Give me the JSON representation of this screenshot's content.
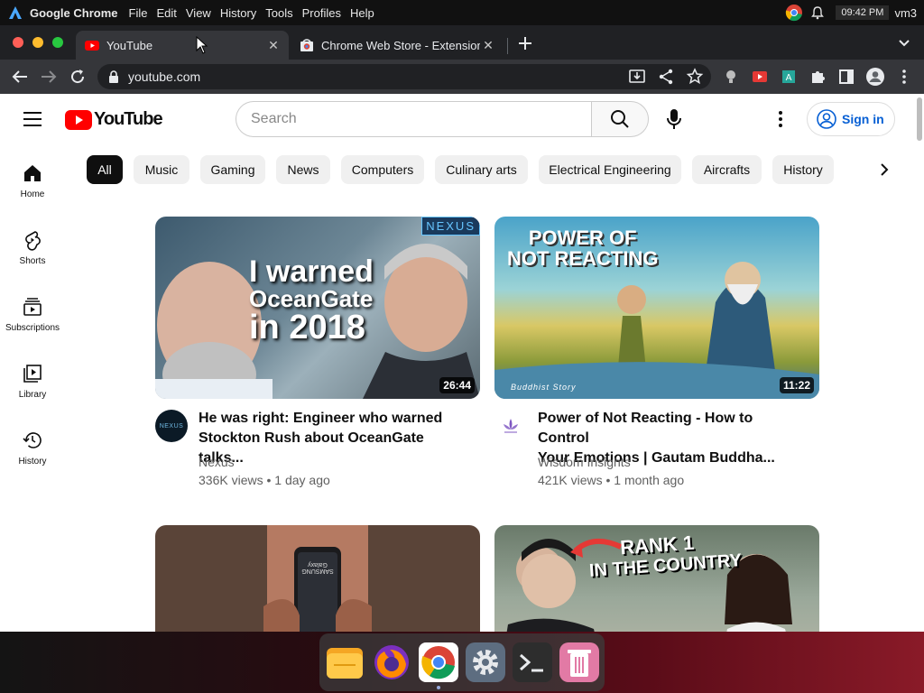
{
  "os_bar": {
    "app_name": "Google Chrome",
    "menus": [
      "File",
      "Edit",
      "View",
      "History",
      "Tools",
      "Profiles",
      "Help"
    ],
    "clock": "09:42 PM",
    "user": "vm3"
  },
  "tabs": [
    {
      "title": "YouTube",
      "active": true
    },
    {
      "title": "Chrome Web Store - Extension",
      "active": false
    }
  ],
  "address_bar": {
    "url": "youtube.com"
  },
  "youtube": {
    "logo_text": "YouTube",
    "search_placeholder": "Search",
    "sign_in": "Sign in",
    "chips": [
      "All",
      "Music",
      "Gaming",
      "News",
      "Computers",
      "Culinary arts",
      "Electrical Engineering",
      "Aircrafts",
      "History"
    ],
    "nav": [
      {
        "label": "Home",
        "icon": "home-icon"
      },
      {
        "label": "Shorts",
        "icon": "shorts-icon"
      },
      {
        "label": "Subscriptions",
        "icon": "subscriptions-icon"
      },
      {
        "label": "Library",
        "icon": "library-icon"
      },
      {
        "label": "History",
        "icon": "history-icon"
      }
    ],
    "videos": [
      {
        "thumb_text": [
          "I warned",
          "OceanGate",
          "in 2018"
        ],
        "thumb_badge": "NEXUS",
        "duration": "26:44",
        "title_line1": "He was right: Engineer who warned",
        "title_line2": "Stockton Rush about OceanGate talks...",
        "channel": "Nexus",
        "avatar_text": "NEXUS",
        "meta": "336K views • 1 day ago"
      },
      {
        "thumb_text": [
          "POWER OF",
          "NOT REACTING"
        ],
        "thumb_caption": "Buddhist Story",
        "duration": "11:22",
        "title_line1": "Power of Not Reacting - How to Control",
        "title_line2": "Your Emotions | Gautam Buddha...",
        "channel": "Wisdom Insights",
        "meta": "421K views • 1 month ago"
      },
      {
        "thumb_text": [
          "SAMSUNG",
          "Galaxy"
        ]
      },
      {
        "thumb_text": [
          "RANK 1",
          "IN THE COUNTRY"
        ]
      }
    ]
  },
  "dock": [
    "files-icon",
    "firefox-icon",
    "chrome-icon",
    "settings-icon",
    "terminal-icon",
    "trash-icon"
  ],
  "colors": {
    "yt_red": "#ff0000",
    "signin_blue": "#065fd4",
    "tab_bg": "#202124",
    "toolbar_bg": "#35363a"
  }
}
